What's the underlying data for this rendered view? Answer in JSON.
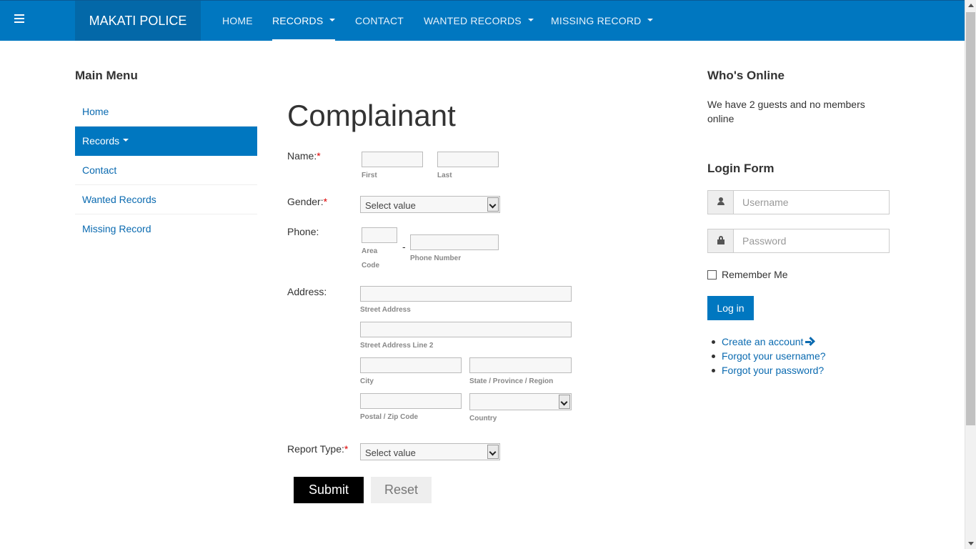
{
  "nav": {
    "brand": "MAKATI POLICE",
    "items": [
      {
        "label": "HOME"
      },
      {
        "label": "RECORDS"
      },
      {
        "label": "CONTACT"
      },
      {
        "label": "WANTED RECORDS"
      },
      {
        "label": "MISSING RECORD"
      }
    ]
  },
  "sidebar": {
    "title": "Main Menu",
    "items": [
      {
        "label": "Home"
      },
      {
        "label": "Records"
      },
      {
        "label": "Contact"
      },
      {
        "label": "Wanted Records"
      },
      {
        "label": "Missing Record"
      }
    ]
  },
  "form": {
    "title": "Complainant",
    "name_label": "Name:",
    "first_sub": "First",
    "last_sub": "Last",
    "gender_label": "Gender:",
    "gender_value": "Select value",
    "phone_label": "Phone:",
    "area_sub_1": "Area",
    "area_sub_2": "Code",
    "phone_sub": "Phone Number",
    "dash": "-",
    "address_label": "Address:",
    "street_sub": "Street Address",
    "street2_sub": "Street Address Line 2",
    "city_sub": "City",
    "state_sub": "State / Province / Region",
    "postal_sub": "Postal / Zip Code",
    "country_sub": "Country",
    "report_label": "Report Type:",
    "report_value": "Select value",
    "required_mark": "*",
    "submit": "Submit",
    "reset": "Reset"
  },
  "right": {
    "online_title": "Who's Online",
    "online_text": "We have 2 guests and no members online",
    "login_title": "Login Form",
    "username_placeholder": "Username",
    "password_placeholder": "Password",
    "remember": "Remember Me",
    "login_button": "Log in",
    "links": {
      "create": "Create an account",
      "forgot_user": "Forgot your username?",
      "forgot_pass": "Forgot your password?"
    }
  },
  "colors": {
    "nav_bg": "#0077c0",
    "brand_bg": "#0368a8",
    "link": "#0a6ab0",
    "required": "#dd0000"
  }
}
